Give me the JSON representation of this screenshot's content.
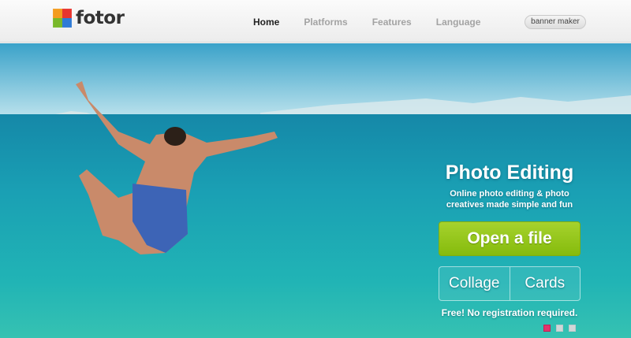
{
  "brand": {
    "name": "fotor"
  },
  "nav": {
    "items": [
      {
        "label": "Home",
        "active": true
      },
      {
        "label": "Platforms",
        "active": false
      },
      {
        "label": "Features",
        "active": false
      },
      {
        "label": "Language",
        "active": false
      }
    ],
    "banner_button": "banner maker"
  },
  "hero": {
    "title": "Photo Editing",
    "subtitle_line1": "Online photo editing & photo",
    "subtitle_line2": "creatives made simple and fun",
    "open_button": "Open a file",
    "collage_button": "Collage",
    "cards_button": "Cards",
    "free_note": "Free! No registration required.",
    "slides": 3,
    "active_slide": 1
  },
  "colors": {
    "accent_green": "#8cc11a",
    "active_dot": "#e3336c",
    "sea": "#1aa6b6"
  }
}
